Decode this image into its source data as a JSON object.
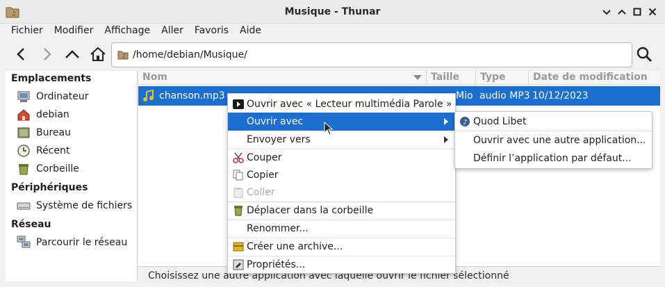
{
  "window": {
    "title": "Musique - Thunar"
  },
  "menubar": [
    "Fichier",
    "Modifier",
    "Affichage",
    "Aller",
    "Favoris",
    "Aide"
  ],
  "toolbar": {
    "path": "/home/debian/Musique/"
  },
  "sidebar": {
    "sections": [
      {
        "heading": "Emplacements",
        "items": [
          {
            "label": "Ordinateur",
            "icon": "computer-icon"
          },
          {
            "label": "debian",
            "icon": "home-folder-icon"
          },
          {
            "label": "Bureau",
            "icon": "desktop-icon"
          },
          {
            "label": "Récent",
            "icon": "recent-clock-icon"
          },
          {
            "label": "Corbeille",
            "icon": "trash-icon"
          }
        ]
      },
      {
        "heading": "Périphériques",
        "items": [
          {
            "label": "Système de fichiers",
            "icon": "drive-icon"
          }
        ]
      },
      {
        "heading": "Réseau",
        "items": [
          {
            "label": "Parcourir le réseau",
            "icon": "network-icon"
          }
        ]
      }
    ]
  },
  "columns": {
    "name": "Nom",
    "size": "Taille",
    "type": "Type",
    "date": "Date de modification"
  },
  "file": {
    "name": "chanson.mp3",
    "size_partial": "Mio",
    "type": "audio MP3",
    "date": "10/12/2023"
  },
  "context_menu": {
    "items": [
      {
        "label": "Ouvrir avec « Lecteur multimédia Parole »",
        "icon": "play-icon"
      },
      {
        "label": "Ouvrir avec",
        "submenu": true,
        "active": true
      },
      {
        "label": "Envoyer vers",
        "submenu": true
      },
      {
        "label": "Couper",
        "icon": "scissors-icon"
      },
      {
        "label": "Copier",
        "icon": "copy-icon"
      },
      {
        "label": "Coller",
        "icon": "paste-icon",
        "disabled": true
      },
      {
        "label": "Déplacer dans la corbeille",
        "icon": "trash-icon"
      },
      {
        "label": "Renommer..."
      },
      {
        "label": "Créer une archive...",
        "icon": "archive-icon"
      },
      {
        "label": "Propriétés...",
        "icon": "properties-icon"
      }
    ]
  },
  "submenu": {
    "items": [
      {
        "label": "Quod Libet",
        "icon": "quodlibet-icon"
      },
      {
        "label": "Ouvrir avec une autre application..."
      },
      {
        "label": "Définir l’application par défaut..."
      }
    ]
  },
  "status": {
    "text": "Choisissez une autre application avec laquelle ouvrir le fichier sélectionné"
  },
  "colors": {
    "selection": "#1c6ecf",
    "background": "#f0f0f0"
  }
}
